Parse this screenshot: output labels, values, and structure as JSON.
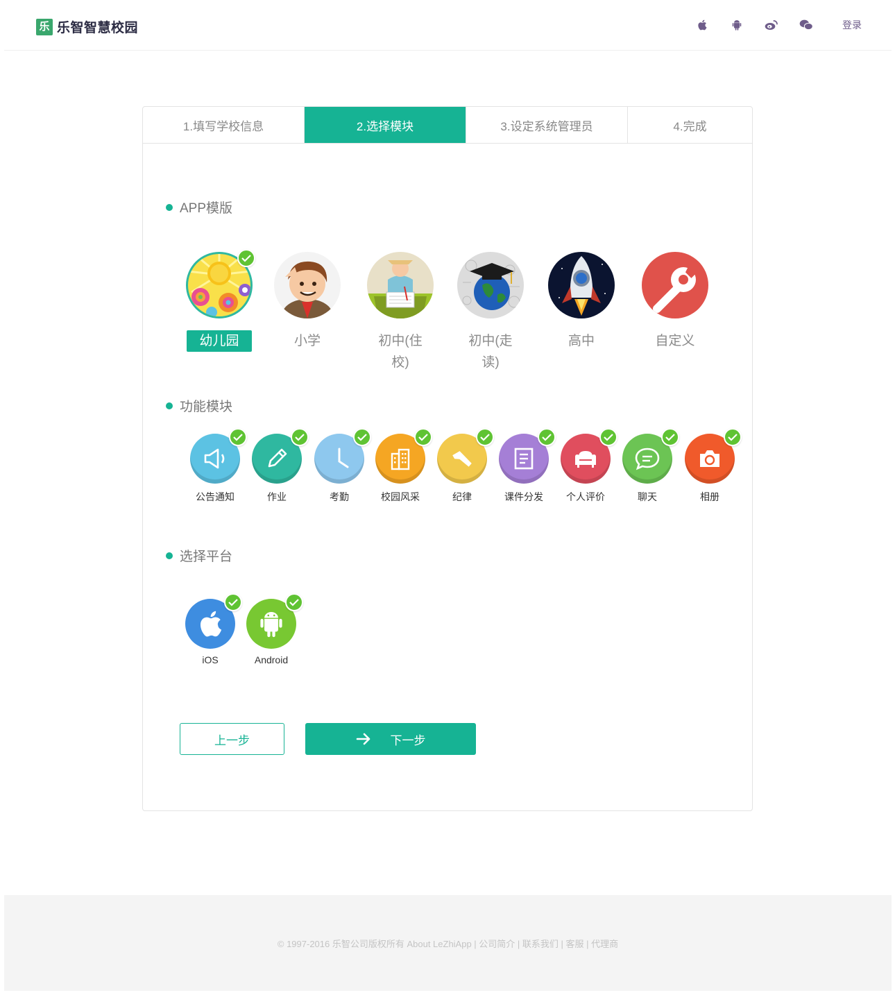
{
  "header": {
    "logo_mark": "乐",
    "logo_text": "乐智智慧校园",
    "icons": [
      "apple-icon",
      "android-icon",
      "weibo-icon",
      "wechat-icon"
    ],
    "login_label": "登录"
  },
  "steps": [
    {
      "label": "1.填写学校信息",
      "active": false
    },
    {
      "label": "2.选择模块",
      "active": true
    },
    {
      "label": "3.设定系统管理员",
      "active": false
    },
    {
      "label": "4.完成",
      "active": false
    }
  ],
  "sections": {
    "app_template": "APP模版",
    "function_module": "功能模块",
    "platform": "选择平台"
  },
  "templates": [
    {
      "label": "幼儿园",
      "selected": true,
      "icon": "kindergarten-icon"
    },
    {
      "label": "小学",
      "selected": false,
      "icon": "primary-school-icon"
    },
    {
      "label": "初中(住校)",
      "selected": false,
      "icon": "middle-school-boarding-icon"
    },
    {
      "label": "初中(走读)",
      "selected": false,
      "icon": "middle-school-day-icon"
    },
    {
      "label": "高中",
      "selected": false,
      "icon": "high-school-icon"
    },
    {
      "label": "自定义",
      "selected": false,
      "icon": "custom-wrench-icon"
    }
  ],
  "modules": [
    {
      "label": "公告通知",
      "color": "#5cc2e3",
      "icon": "megaphone-icon",
      "checked": true
    },
    {
      "label": "作业",
      "color": "#2fb8a0",
      "icon": "pencil-icon",
      "checked": true
    },
    {
      "label": "考勤",
      "color": "#8ec8ee",
      "icon": "clock-icon",
      "checked": true
    },
    {
      "label": "校园风采",
      "color": "#f5a623",
      "icon": "building-icon",
      "checked": true
    },
    {
      "label": "纪律",
      "color": "#f2c94c",
      "icon": "flashlight-icon",
      "checked": true
    },
    {
      "label": "课件分发",
      "color": "#a57fd6",
      "icon": "document-icon",
      "checked": true
    },
    {
      "label": "个人评价",
      "color": "#e04e5e",
      "icon": "sofa-icon",
      "checked": true
    },
    {
      "label": "聊天",
      "color": "#6cc454",
      "icon": "chat-bubble-icon",
      "checked": true
    },
    {
      "label": "相册",
      "color": "#f05a2b",
      "icon": "camera-icon",
      "checked": true
    }
  ],
  "platforms": [
    {
      "label": "iOS",
      "color": "#3e8de0",
      "icon": "apple-icon",
      "checked": true
    },
    {
      "label": "Android",
      "color": "#78c832",
      "icon": "android-icon",
      "checked": true
    }
  ],
  "buttons": {
    "prev": "上一步",
    "next": "下一步"
  },
  "footer": {
    "text": "© 1997-2016 乐智公司版权所有 About LeZhiApp | 公司简介 | 联系我们 | 客服 | 代理商"
  },
  "colors": {
    "accent": "#16b394",
    "check": "#5fc333"
  }
}
